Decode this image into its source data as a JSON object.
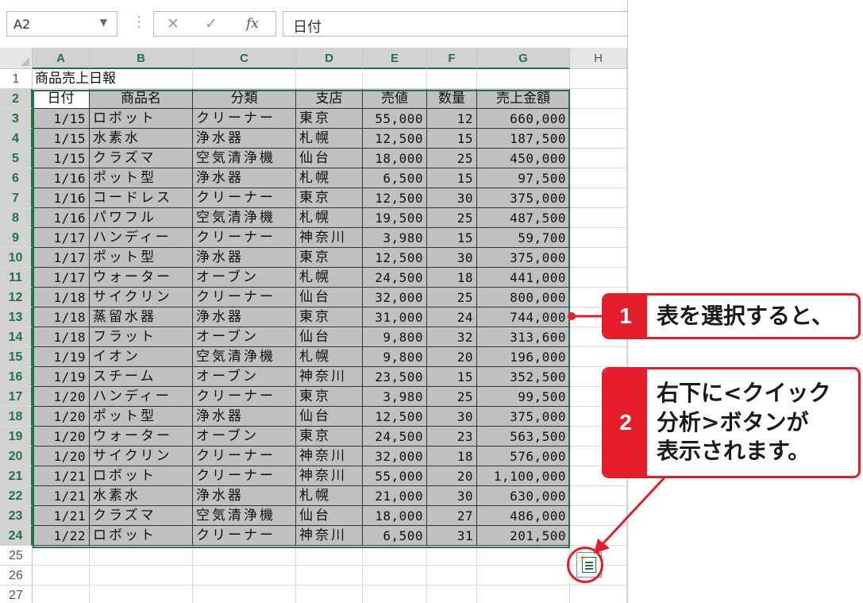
{
  "formula_bar": {
    "name_box": "A2",
    "name_box_dropdown": "▼",
    "separator": "⋮",
    "cancel_glyph": "✕",
    "enter_glyph": "✓",
    "function_glyph": "fx",
    "content": "日付"
  },
  "columns": [
    "A",
    "B",
    "C",
    "D",
    "E",
    "F",
    "G",
    "H"
  ],
  "rows": [
    "1",
    "2",
    "3",
    "4",
    "5",
    "6",
    "7",
    "8",
    "9",
    "10",
    "11",
    "12",
    "13",
    "14",
    "15",
    "16",
    "17",
    "18",
    "19",
    "20",
    "21",
    "22",
    "23",
    "24",
    "25",
    "26",
    "27"
  ],
  "title": "商品売上日報",
  "headers": [
    "日付",
    "商品名",
    "分類",
    "支店",
    "売値",
    "数量",
    "売上金額"
  ],
  "records": [
    [
      "1/15",
      "ロボット",
      "クリーナー",
      "東京",
      "55,000",
      "12",
      "660,000"
    ],
    [
      "1/15",
      "水素水",
      "浄水器",
      "札幌",
      "12,500",
      "15",
      "187,500"
    ],
    [
      "1/15",
      "クラズマ",
      "空気清浄機",
      "仙台",
      "18,000",
      "25",
      "450,000"
    ],
    [
      "1/16",
      "ポット型",
      "浄水器",
      "札幌",
      "6,500",
      "15",
      "97,500"
    ],
    [
      "1/16",
      "コードレス",
      "クリーナー",
      "東京",
      "12,500",
      "30",
      "375,000"
    ],
    [
      "1/16",
      "パワフル",
      "空気清浄機",
      "札幌",
      "19,500",
      "25",
      "487,500"
    ],
    [
      "1/17",
      "ハンディー",
      "クリーナー",
      "神奈川",
      "3,980",
      "15",
      "59,700"
    ],
    [
      "1/17",
      "ポット型",
      "浄水器",
      "東京",
      "12,500",
      "30",
      "375,000"
    ],
    [
      "1/17",
      "ウォーター",
      "オーブン",
      "札幌",
      "24,500",
      "18",
      "441,000"
    ],
    [
      "1/18",
      "サイクリン",
      "クリーナー",
      "仙台",
      "32,000",
      "25",
      "800,000"
    ],
    [
      "1/18",
      "蒸留水器",
      "浄水器",
      "東京",
      "31,000",
      "24",
      "744,000"
    ],
    [
      "1/18",
      "フラット",
      "オーブン",
      "仙台",
      "9,800",
      "32",
      "313,600"
    ],
    [
      "1/19",
      "イオン",
      "空気清浄機",
      "札幌",
      "9,800",
      "20",
      "196,000"
    ],
    [
      "1/19",
      "スチーム",
      "オーブン",
      "神奈川",
      "23,500",
      "15",
      "352,500"
    ],
    [
      "1/20",
      "ハンディー",
      "クリーナー",
      "東京",
      "3,980",
      "25",
      "99,500"
    ],
    [
      "1/20",
      "ポット型",
      "浄水器",
      "仙台",
      "12,500",
      "30",
      "375,000"
    ],
    [
      "1/20",
      "ウォーター",
      "オーブン",
      "東京",
      "24,500",
      "23",
      "563,500"
    ],
    [
      "1/20",
      "サイクリン",
      "クリーナー",
      "神奈川",
      "32,000",
      "18",
      "576,000"
    ],
    [
      "1/21",
      "ロボット",
      "クリーナー",
      "神奈川",
      "55,000",
      "20",
      "1,100,000"
    ],
    [
      "1/21",
      "水素水",
      "浄水器",
      "札幌",
      "21,000",
      "30",
      "630,000"
    ],
    [
      "1/21",
      "クラズマ",
      "空気清浄機",
      "仙台",
      "18,000",
      "27",
      "486,000"
    ],
    [
      "1/22",
      "ロボット",
      "クリーナー",
      "神奈川",
      "6,500",
      "31",
      "201,500"
    ]
  ],
  "callouts": [
    {
      "number": "1",
      "text": "表を選択すると、"
    },
    {
      "number": "2",
      "text": "右下に<クイック\n分析>ボタンが\n表示されます。"
    }
  ],
  "quick_analysis_icon": "quick-analysis-icon",
  "colors": {
    "accent_green": "#217346",
    "callout_red": "#e51d2a",
    "selection_fill": "#c0c0c0"
  }
}
